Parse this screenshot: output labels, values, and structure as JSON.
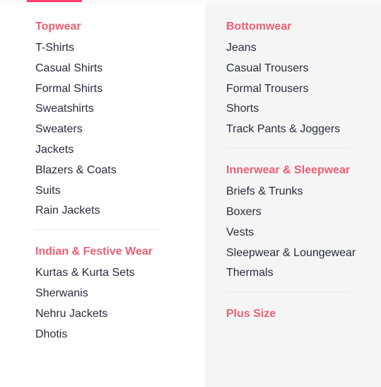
{
  "left_column": {
    "groups": [
      {
        "heading": "Topwear",
        "items": [
          "T-Shirts",
          "Casual Shirts",
          "Formal Shirts",
          "Sweatshirts",
          "Sweaters",
          "Jackets",
          "Blazers & Coats",
          "Suits",
          "Rain Jackets"
        ]
      },
      {
        "heading": "Indian & Festive Wear",
        "items": [
          "Kurtas & Kurta Sets",
          "Sherwanis",
          "Nehru Jackets",
          "Dhotis"
        ]
      }
    ]
  },
  "right_column": {
    "groups": [
      {
        "heading": "Bottomwear",
        "items": [
          "Jeans",
          "Casual Trousers",
          "Formal Trousers",
          "Shorts",
          "Track Pants & Joggers"
        ]
      },
      {
        "heading": "Innerwear & Sleepwear",
        "items": [
          "Briefs & Trunks",
          "Boxers",
          "Vests",
          "Sleepwear & Loungewear",
          "Thermals"
        ]
      },
      {
        "heading": "Plus Size",
        "items": []
      }
    ]
  },
  "colors": {
    "accent": "#ff3f6c",
    "heading": "#ee5f73",
    "text": "#282c3f",
    "divider": "#eaeaec"
  }
}
